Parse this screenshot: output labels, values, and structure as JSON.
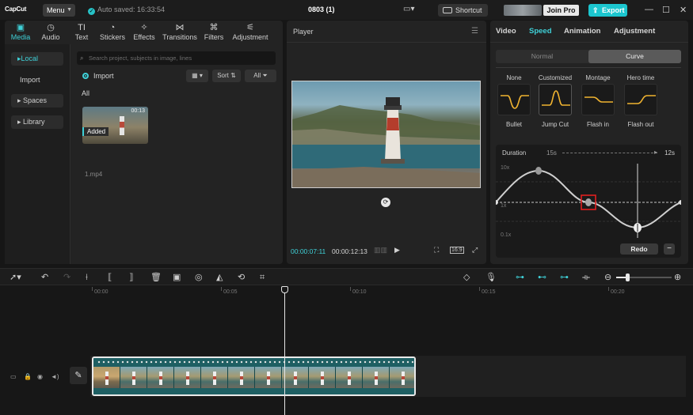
{
  "titlebar": {
    "logo": "CapCut",
    "menu_label": "Menu",
    "autosave": "Auto saved: 16:33:54",
    "project_name": "0803 (1)",
    "shortcut_label": "Shortcut",
    "joinpro_label": "Join Pro",
    "export_label": "Export"
  },
  "media": {
    "tabs": [
      {
        "label": "Media",
        "icon": "media-icon"
      },
      {
        "label": "Audio",
        "icon": "audio-icon"
      },
      {
        "label": "Text",
        "icon": "text-icon"
      },
      {
        "label": "Stickers",
        "icon": "stickers-icon"
      },
      {
        "label": "Effects",
        "icon": "effects-icon"
      },
      {
        "label": "Transitions",
        "icon": "transitions-icon"
      },
      {
        "label": "Filters",
        "icon": "filters-icon"
      },
      {
        "label": "Adjustment",
        "icon": "adjustment-icon"
      }
    ],
    "sidebar": {
      "local": "Local",
      "import": "Import",
      "spaces": "Spaces",
      "library": "Library"
    },
    "search_placeholder": "Search project, subjects in image, lines",
    "import_label": "Import",
    "sort_label": "Sort",
    "all_filter": "All",
    "all_heading": "All",
    "clip": {
      "badge": "Added",
      "duration": "00:13",
      "name": "1.mp4"
    }
  },
  "player": {
    "title": "Player",
    "current_time": "00:00:07:11",
    "total_time": "00:00:12:13",
    "ratio_label": "16:9"
  },
  "properties": {
    "tabs": [
      "Video",
      "Speed",
      "Animation",
      "Adjustment"
    ],
    "speed_modes": [
      "Normal",
      "Curve"
    ],
    "presets_top": [
      "None",
      "Customized",
      "Montage",
      "Hero time"
    ],
    "presets_bottom": [
      "Bullet",
      "Jump Cut",
      "Flash in",
      "Flash out"
    ],
    "duration_label": "Duration",
    "duration_from": "15s",
    "duration_to": "12s",
    "y_labels": [
      "10x",
      "1x",
      "0.1x"
    ],
    "redo_label": "Redo"
  },
  "timeline": {
    "ruler": [
      "00:00",
      "00:05",
      "00:10",
      "00:15",
      "00:20"
    ]
  },
  "colors": {
    "accent": "#3fd1d8",
    "clip": "#1e5f63",
    "highlight_box": "#e02020"
  }
}
